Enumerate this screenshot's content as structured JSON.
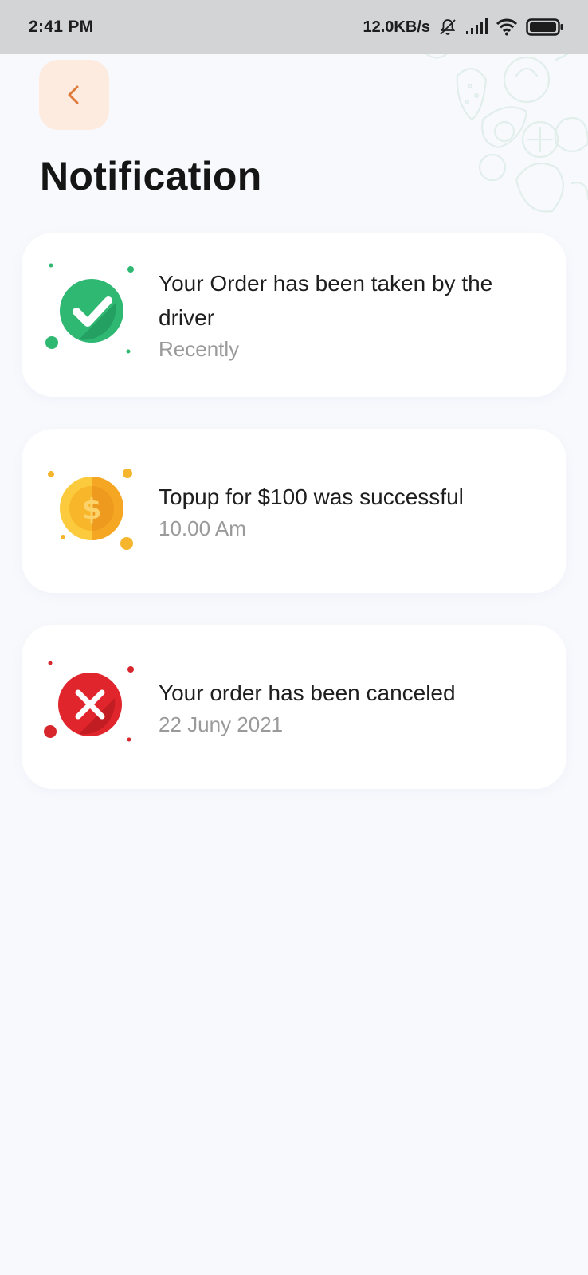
{
  "status_bar": {
    "time": "2:41 PM",
    "speed": "12.0KB/s"
  },
  "page": {
    "title": "Notification"
  },
  "notifications": [
    {
      "title": "Your Order has been taken by the driver",
      "time": "Recently",
      "icon": "check-icon",
      "color": "#2eb872"
    },
    {
      "title": "Topup for $100 was successful",
      "time": "10.00 Am",
      "icon": "coin-icon",
      "color": "#f5b52d"
    },
    {
      "title": "Your order has been canceled",
      "time": "22 Juny 2021",
      "icon": "cancel-icon",
      "color": "#d7262c"
    }
  ],
  "colors": {
    "background": "#f8f9fd",
    "back_button_bg": "#fdebe0",
    "back_arrow": "#e07a3a",
    "status_bar_bg": "#d3d4d6"
  }
}
